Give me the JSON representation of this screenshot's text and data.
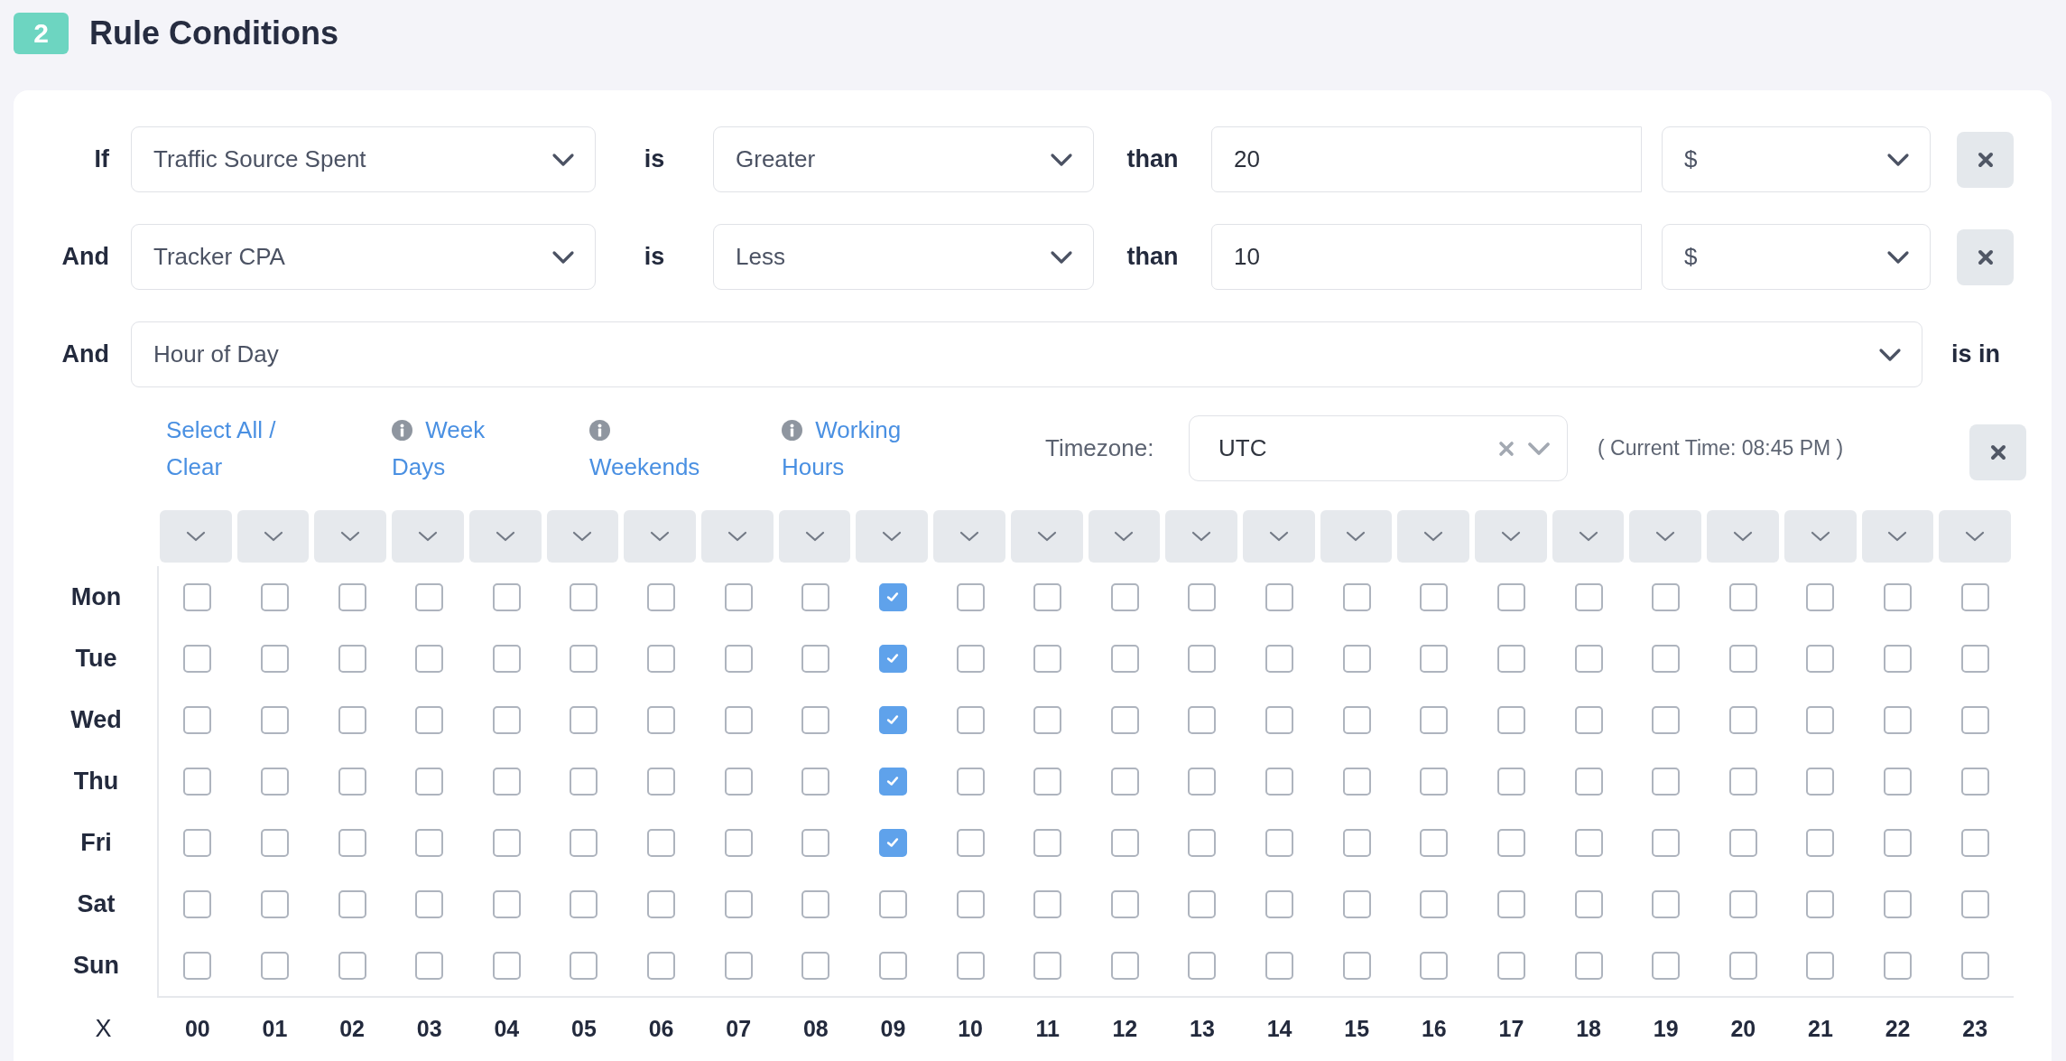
{
  "section": {
    "number": "2",
    "title": "Rule Conditions"
  },
  "conditions": [
    {
      "kind": "comparison",
      "connector": "If",
      "metric": "Traffic Source Spent",
      "operator_label": "is",
      "operator": "Greater",
      "than_label": "than",
      "value": "20",
      "unit": "$"
    },
    {
      "kind": "comparison",
      "connector": "And",
      "metric": "Tracker CPA",
      "operator_label": "is",
      "operator": "Less",
      "than_label": "than",
      "value": "10",
      "unit": "$"
    },
    {
      "kind": "schedule",
      "connector": "And",
      "metric": "Hour of Day",
      "suffix": "is in",
      "schedule": {
        "quick_links": [
          {
            "label": "Select All / Clear",
            "info": false
          },
          {
            "label": "Week Days",
            "info": true
          },
          {
            "label": "Weekends",
            "info": true
          },
          {
            "label": "Working Hours",
            "info": true
          }
        ],
        "timezone_label": "Timezone:",
        "timezone": "UTC",
        "current_time": "( Current Time: 08:45 PM )",
        "corner_label": "X",
        "hours": [
          "00",
          "01",
          "02",
          "03",
          "04",
          "05",
          "06",
          "07",
          "08",
          "09",
          "10",
          "11",
          "12",
          "13",
          "14",
          "15",
          "16",
          "17",
          "18",
          "19",
          "20",
          "21",
          "22",
          "23"
        ],
        "days": [
          {
            "label": "Mon",
            "checked": [
              false,
              false,
              false,
              false,
              false,
              false,
              false,
              false,
              false,
              true,
              false,
              false,
              false,
              false,
              false,
              false,
              false,
              false,
              false,
              false,
              false,
              false,
              false,
              false
            ]
          },
          {
            "label": "Tue",
            "checked": [
              false,
              false,
              false,
              false,
              false,
              false,
              false,
              false,
              false,
              true,
              false,
              false,
              false,
              false,
              false,
              false,
              false,
              false,
              false,
              false,
              false,
              false,
              false,
              false
            ]
          },
          {
            "label": "Wed",
            "checked": [
              false,
              false,
              false,
              false,
              false,
              false,
              false,
              false,
              false,
              true,
              false,
              false,
              false,
              false,
              false,
              false,
              false,
              false,
              false,
              false,
              false,
              false,
              false,
              false
            ]
          },
          {
            "label": "Thu",
            "checked": [
              false,
              false,
              false,
              false,
              false,
              false,
              false,
              false,
              false,
              true,
              false,
              false,
              false,
              false,
              false,
              false,
              false,
              false,
              false,
              false,
              false,
              false,
              false,
              false
            ]
          },
          {
            "label": "Fri",
            "checked": [
              false,
              false,
              false,
              false,
              false,
              false,
              false,
              false,
              false,
              true,
              false,
              false,
              false,
              false,
              false,
              false,
              false,
              false,
              false,
              false,
              false,
              false,
              false,
              false
            ]
          },
          {
            "label": "Sat",
            "checked": [
              false,
              false,
              false,
              false,
              false,
              false,
              false,
              false,
              false,
              false,
              false,
              false,
              false,
              false,
              false,
              false,
              false,
              false,
              false,
              false,
              false,
              false,
              false,
              false
            ]
          },
          {
            "label": "Sun",
            "checked": [
              false,
              false,
              false,
              false,
              false,
              false,
              false,
              false,
              false,
              false,
              false,
              false,
              false,
              false,
              false,
              false,
              false,
              false,
              false,
              false,
              false,
              false,
              false,
              false
            ]
          }
        ]
      }
    }
  ]
}
